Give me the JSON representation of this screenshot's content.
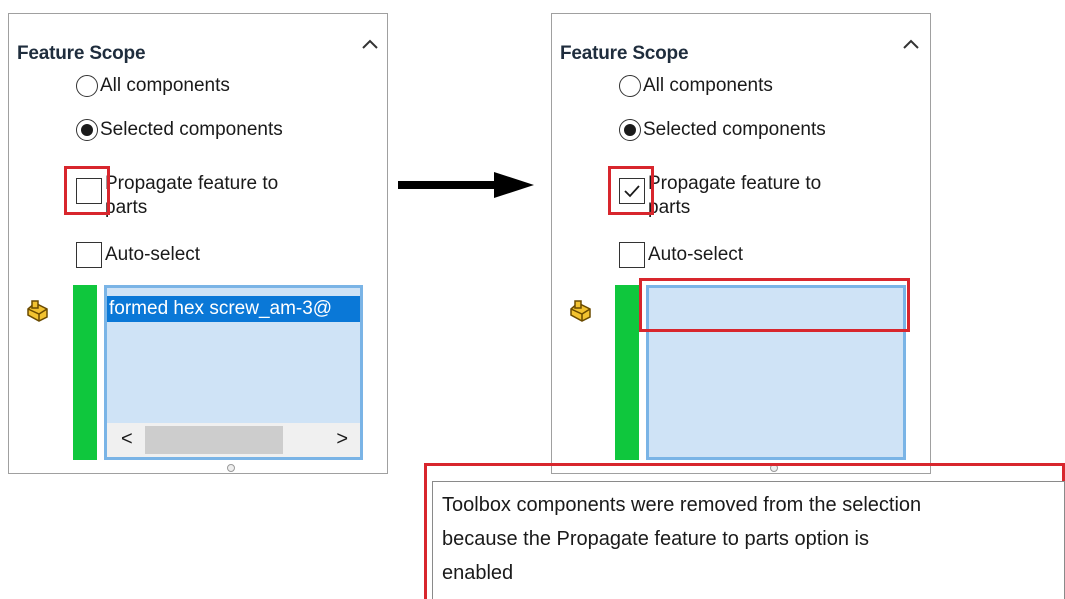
{
  "before_panel": {
    "title": "Feature Scope",
    "radio_all": "All components",
    "radio_selected": "Selected components",
    "propagate_line1": "Propagate feature to",
    "propagate_line2": "parts",
    "auto_select": "Auto-select",
    "list_item": "formed hex screw_am-3@",
    "scroll_left": "<",
    "scroll_right": ">"
  },
  "after_panel": {
    "title": "Feature Scope",
    "radio_all": "All components",
    "radio_selected": "Selected components",
    "propagate_line1": "Propagate feature to",
    "propagate_line2": "parts",
    "auto_select": "Auto-select"
  },
  "tooltip": {
    "line1": "Toolbox components were removed from the selection",
    "line2": "because the Propagate feature to parts option is",
    "line3": "enabled"
  },
  "state": {
    "before": {
      "selected_radio": "Selected components",
      "propagate_checked": false,
      "auto_select_checked": false
    },
    "after": {
      "selected_radio": "Selected components",
      "propagate_checked": true,
      "auto_select_checked": false
    }
  },
  "colors": {
    "highlight_red": "#d8262d",
    "green_bar": "#0fc73d",
    "list_bg": "#cfe3f6",
    "list_border": "#7ab4e6",
    "selection_blue": "#0a78d7"
  },
  "icons": [
    "chevron-up-icon",
    "component-icon",
    "arrow-right-icon",
    "checkmark-icon"
  ]
}
